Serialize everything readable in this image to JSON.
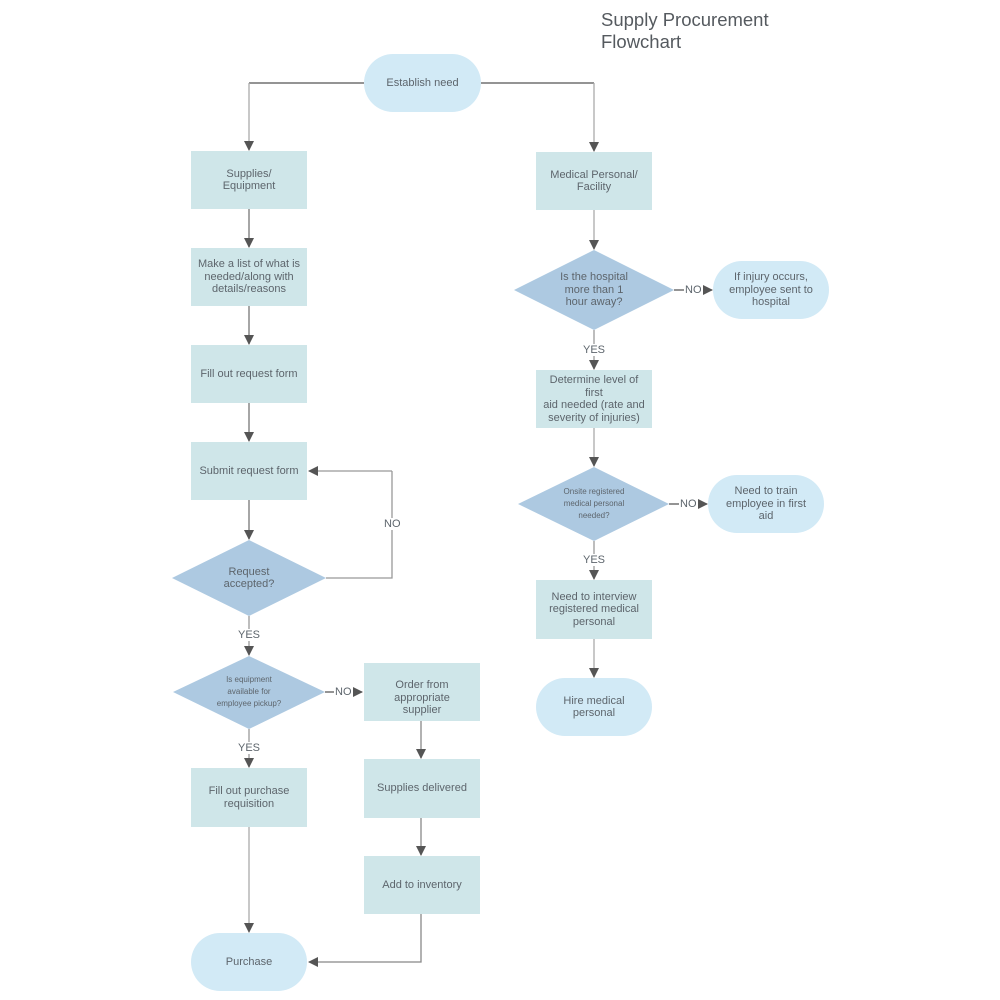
{
  "title": "Supply Procurement\nFlowchart",
  "colors": {
    "process_fill": "#cfe6e9",
    "terminal_fill": "#d2eaf6",
    "decision_fill": "#adc9e1",
    "connector_dark": "#555555",
    "connector_light": "#aaaaaa",
    "text": "#5d656c"
  },
  "nodes": {
    "establish_need": "Establish need",
    "supplies_equipment": "Supplies/\nEquipment",
    "make_list": "Make a list of what is\nneeded/along with\ndetails/reasons",
    "fill_request": "Fill out request form",
    "submit_request": "Submit request form",
    "request_accepted": "Request\naccepted?",
    "equipment_available": "Is equipment\navailable for\nemployee pickup?",
    "fill_purchase": "Fill out purchase\nrequisition",
    "purchase": "Purchase",
    "order_supplier": "Order from appropriate\nsupplier",
    "supplies_delivered": "Supplies delivered",
    "add_inventory": "Add to inventory",
    "medical_facility": "Medical Personal/\nFacility",
    "hospital_distance": "Is the hospital\nmore than 1\nhour away?",
    "injury_hospital": "If injury occurs,\nemployee sent to\nhospital",
    "first_aid_level": "Determine level of first\naid needed (rate and\nseverity of injuries)",
    "onsite_medical": "Onsite registered\nmedical personal\nneeded?",
    "train_first_aid": "Need to train\nemployee in first\naid",
    "interview_medical": "Need to interview\nregistered medical\npersonal",
    "hire_medical": "Hire medical\npersonal"
  },
  "labels": {
    "no_request": "NO",
    "yes_request": "YES",
    "no_equipment": "NO",
    "yes_equipment": "YES",
    "no_hospital": "NO",
    "yes_hospital": "YES",
    "no_onsite": "NO",
    "yes_onsite": "YES"
  }
}
